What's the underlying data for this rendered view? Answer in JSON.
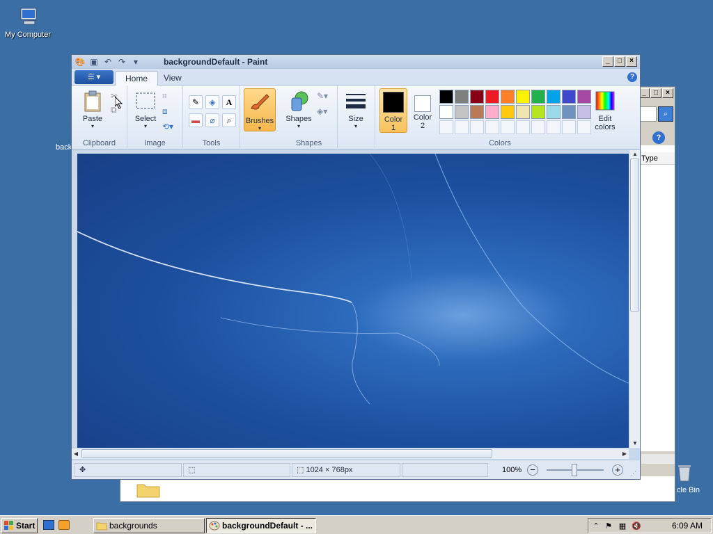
{
  "desktop": {
    "icons": [
      {
        "label": "My Computer"
      },
      {
        "label": "back"
      },
      {
        "label": "cle Bin"
      }
    ]
  },
  "background_window": {
    "column_header": "Type"
  },
  "paint": {
    "title": "backgroundDefault - Paint",
    "tabs": [
      "Home",
      "View"
    ],
    "groups": {
      "clipboard": "Clipboard",
      "image": "Image",
      "tools": "Tools",
      "shapes": "Shapes",
      "colors": "Colors"
    },
    "buttons": {
      "paste": "Paste",
      "select": "Select",
      "brushes": "Brushes",
      "shapes": "Shapes",
      "size": "Size",
      "color1": "Color\n1",
      "color2": "Color\n2",
      "edit_colors": "Edit\ncolors"
    },
    "colors": {
      "accent": "#3a74c8",
      "palette_row1": [
        "#000000",
        "#7f7f7f",
        "#880015",
        "#ed1c24",
        "#ff7f27",
        "#fff200",
        "#22b14c",
        "#00a2e8",
        "#3f48cc",
        "#a349a4"
      ],
      "palette_row2": [
        "#ffffff",
        "#c3c3c3",
        "#b97a57",
        "#ffaec9",
        "#ffc90e",
        "#efe4b0",
        "#b5e61d",
        "#99d9ea",
        "#7092be",
        "#c8bfe7"
      ],
      "color1": "#000000",
      "color2": "#ffffff"
    },
    "status": {
      "dimensions": "1024 × 768px",
      "zoom": "100%"
    }
  },
  "taskbar": {
    "start": "Start",
    "tasks": [
      "backgrounds",
      "backgroundDefault - ..."
    ],
    "clock": "6:09 AM"
  }
}
